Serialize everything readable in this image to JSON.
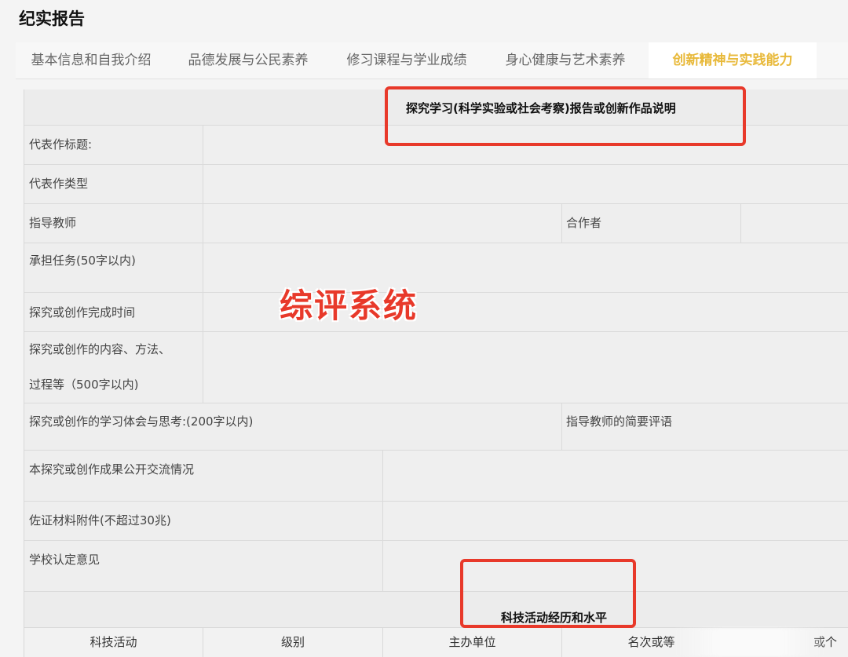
{
  "page_title": "纪实报告",
  "tabs": [
    {
      "label": "基本信息和自我介绍",
      "active": false
    },
    {
      "label": "品德发展与公民素养",
      "active": false
    },
    {
      "label": "修习课程与学业成绩",
      "active": false
    },
    {
      "label": "身心健康与艺术素养",
      "active": false
    },
    {
      "label": "创新精神与实践能力",
      "active": true
    }
  ],
  "form": {
    "section1_title": "探究学习(科学实验或社会考察)报告或创新作品说明",
    "fields": {
      "title": "代表作标题:",
      "type": "代表作类型",
      "teacher": "指导教师",
      "partner": "合作者",
      "task": "承担任务(50字以内)",
      "completion_time": "探究或创作完成时间",
      "content_line1": "探究或创作的内容、方法、",
      "content_line2": "过程等（500字以内)",
      "reflection": "探究或创作的学习体会与思考:(200字以内)",
      "teacher_comment": "指导教师的简要评语",
      "exchange": "本探究或创作成果公开交流情况",
      "attachment": "佐证材料附件(不超过30兆)",
      "school_opinion": "学校认定意见"
    },
    "section2_title": "科技活动经历和水平",
    "table_columns": [
      "科技活动",
      "级别",
      "主办单位",
      "名次或等",
      "或个"
    ]
  },
  "watermark": "综评系统",
  "colors": {
    "accent_tab": "#e8b93a",
    "highlight_red": "#e8392a"
  }
}
